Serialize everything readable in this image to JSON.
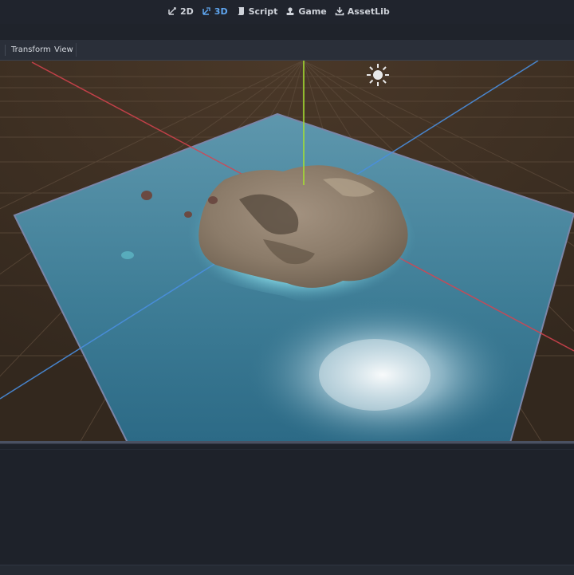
{
  "workspace_tabs": [
    {
      "label": "2D",
      "icon": "2d-icon",
      "active": false
    },
    {
      "label": "3D",
      "icon": "3d-icon",
      "active": true
    },
    {
      "label": "Script",
      "icon": "script-icon",
      "active": false
    },
    {
      "label": "Game",
      "icon": "game-icon",
      "active": false
    },
    {
      "label": "AssetLib",
      "icon": "assetlib-icon",
      "active": false
    }
  ],
  "viewport_menu": {
    "transform_label": "Transform",
    "view_label": "View"
  },
  "colors": {
    "accent": "#5fa6f0",
    "x_axis": "#d8434f",
    "y_axis": "#a6e22e",
    "z_axis": "#4a8fe0",
    "water": "#4f8fa6",
    "ground": "#3b2e23"
  },
  "scene_objects": [
    "water-plane",
    "island-terrain",
    "rock-1",
    "rock-2",
    "rock-3",
    "sun-light"
  ]
}
